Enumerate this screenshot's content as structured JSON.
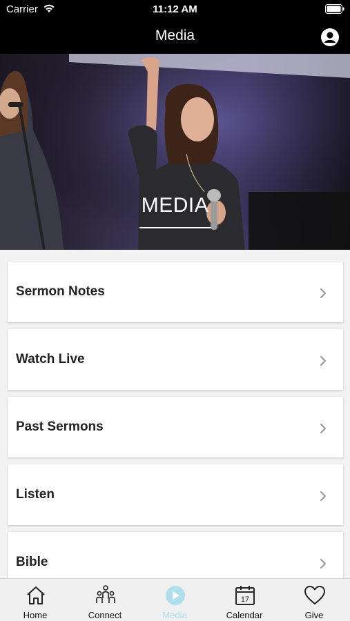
{
  "status_bar": {
    "carrier": "Carrier",
    "time": "11:12 AM"
  },
  "nav": {
    "title": "Media"
  },
  "hero": {
    "title": "MEDIA"
  },
  "menu": {
    "items": [
      {
        "label": "Sermon Notes"
      },
      {
        "label": "Watch Live"
      },
      {
        "label": "Past Sermons"
      },
      {
        "label": "Listen"
      },
      {
        "label": "Bible"
      }
    ]
  },
  "tabs": {
    "home": "Home",
    "connect": "Connect",
    "media": "Media",
    "calendar": "Calendar",
    "calendar_day": "17",
    "give": "Give"
  },
  "colors": {
    "active_tab": "#aee0ec",
    "bar_bg": "#000000"
  }
}
